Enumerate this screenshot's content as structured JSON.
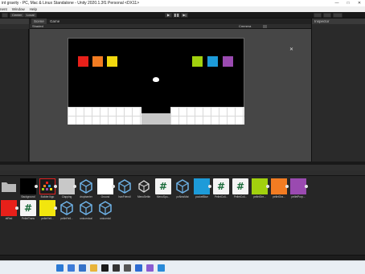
{
  "window": {
    "title": "int gravity - PC, Mac & Linux Standalone - Unity 2020.1.3f1 Personal <DX11>",
    "controls": [
      "—",
      "□",
      "✕"
    ]
  },
  "menu": [
    "nent",
    "Window",
    "Help"
  ],
  "toolbar": {
    "center_label": "Center",
    "local_label": "Local",
    "play_glyph": "▶",
    "pause_glyph": "❚❚",
    "step_glyph": "▶|"
  },
  "scene": {
    "tabs": [
      "Scene",
      "Game"
    ],
    "shading_mode": "Shaded",
    "camera_label": "Cmmera",
    "left_squares": [
      "#e8201a",
      "#f27c22",
      "#f2d80e"
    ],
    "right_squares": [
      "#a2d10e",
      "#1d9bd9",
      "#9a4ab0"
    ]
  },
  "inspector": {
    "tab_label": "Inspector"
  },
  "project": {
    "row1": [
      {
        "label": "",
        "kind": "folder",
        "color": "#b8b8b8"
      },
      {
        "label": "Background",
        "kind": "sprite",
        "color": "#000000"
      },
      {
        "label": "Builder.Ikgo",
        "kind": "pixel",
        "color": "#1a1a1a"
      },
      {
        "label": "Clapping",
        "kind": "sprite",
        "color": "#c8c8c8"
      },
      {
        "label": "dropbarrier",
        "kind": "prefab",
        "color": "#6fb3e8"
      },
      {
        "label": "Ground",
        "kind": "sprite",
        "color": "#ffffff"
      },
      {
        "label": "hanFriendl",
        "kind": "prefab",
        "color": "#6fb3e8"
      },
      {
        "label": "MenuSettin",
        "kind": "unity",
        "color": "#ffffff"
      },
      {
        "label": "MenuSpo...",
        "kind": "script",
        "color": "#ffffff"
      },
      {
        "label": "pcNewMat",
        "kind": "prefab",
        "color": "#6fb3e8"
      },
      {
        "label": "pocketBlue",
        "kind": "sprite",
        "color": "#1d9bd9"
      },
      {
        "label": "PelletColl...",
        "kind": "script",
        "color": "#ffffff"
      },
      {
        "label": "PelletColl...",
        "kind": "script",
        "color": "#ffffff"
      },
      {
        "label": "pelletGre...",
        "kind": "sprite",
        "color": "#a2d10e"
      },
      {
        "label": "pelletOra...",
        "kind": "sprite",
        "color": "#f27c22"
      },
      {
        "label": "pelletPurp...",
        "kind": "sprite",
        "color": "#9a4ab0"
      }
    ],
    "row2": [
      {
        "label": "etRed",
        "kind": "sprite",
        "color": "#e8201a"
      },
      {
        "label": "PelletTrans",
        "kind": "script",
        "color": "#ffffff"
      },
      {
        "label": "pelletYell...",
        "kind": "sprite",
        "color": "#f2e60e"
      },
      {
        "label": "pelletYell...",
        "kind": "prefab",
        "color": "#6fb3e8"
      },
      {
        "label": "unicornIcal",
        "kind": "prefab",
        "color": "#6fb3e8"
      },
      {
        "label": "unicornIcl",
        "kind": "prefab",
        "color": "#6fb3e8"
      }
    ]
  },
  "taskbar": {
    "icons": [
      "edge-icon",
      "mail-icon",
      "store-icon",
      "folder-icon",
      "terminal-icon",
      "unity-icon",
      "settings-icon",
      "photos-icon",
      "app-icon",
      "vscode-icon"
    ]
  }
}
